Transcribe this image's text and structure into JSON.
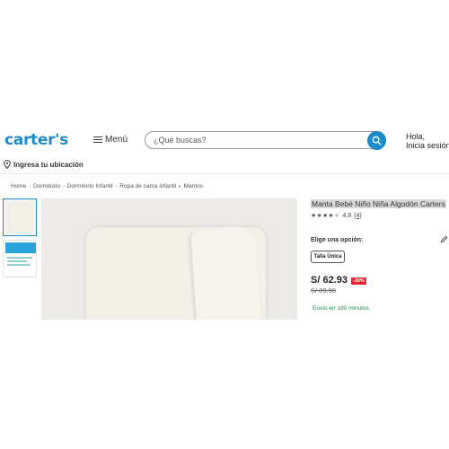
{
  "header": {
    "logo": "carter's",
    "menu_label": "Menú",
    "search_placeholder": "¿Qué buscas?",
    "greeting_line1": "Hola,",
    "greeting_line2": "Inicia sesión"
  },
  "location": {
    "label": "Ingresa tu ubicación"
  },
  "breadcrumb": [
    "Home",
    "Dormitorio",
    "Dormitorio Infantil",
    "Ropa de cama infantil",
    "Mantos"
  ],
  "product": {
    "title": "Manta Bebé Niño Niña Algodón Carters",
    "rating": {
      "stars": 4,
      "max": 5,
      "value": "4.8",
      "count": "(4)"
    },
    "options_label": "Elige una opción:",
    "size": "Talla Única",
    "price": "S/ 62.93",
    "discount": "-30%",
    "old_price": "S/ 89.90",
    "shipping": "Envío en 180 minutos"
  },
  "colors": {
    "brand": "#1e8ac9",
    "discount": "#e8242b",
    "shipping": "#1a8a4c"
  },
  "icons": [
    "hamburger-icon",
    "search-icon",
    "location-pin-icon",
    "chevron-right-icon",
    "star-icon",
    "edit-icon"
  ]
}
